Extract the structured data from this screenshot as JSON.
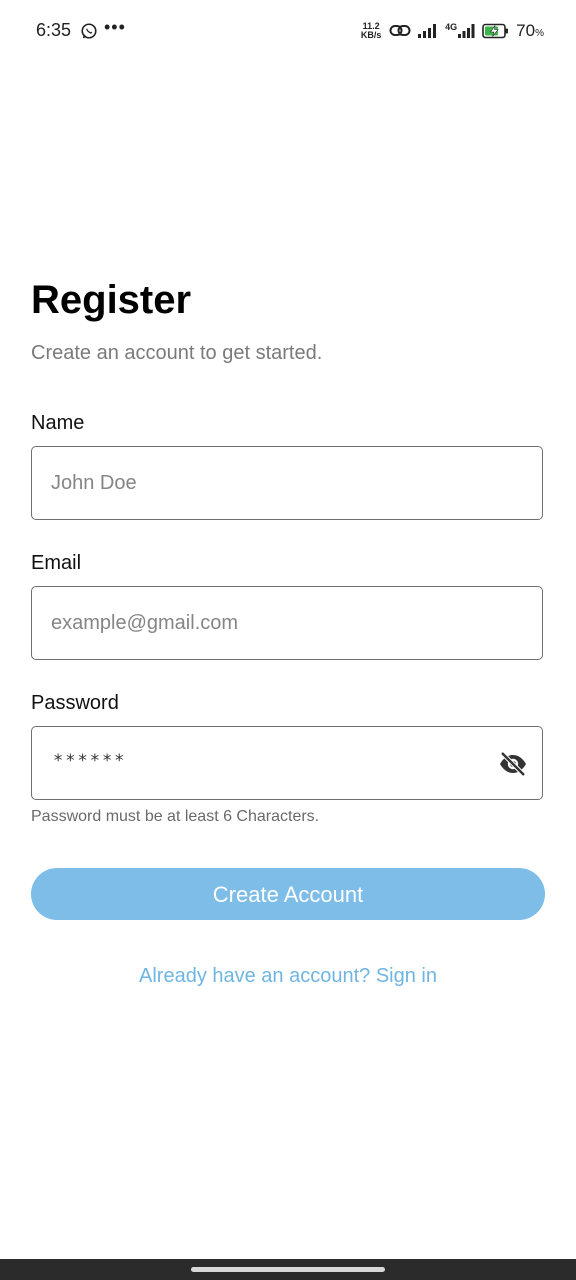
{
  "status_bar": {
    "time": "6:35",
    "net_speed_value": "11.2",
    "net_speed_unit": "KB/s",
    "network_type": "4G",
    "battery_percent": "70",
    "battery_unit": "%",
    "icons": [
      "whatsapp-icon",
      "more-dots-icon",
      "link-icon",
      "signal-icon",
      "battery-charging-icon"
    ]
  },
  "header": {
    "title": "Register",
    "subtitle": "Create an account to get started."
  },
  "form": {
    "name": {
      "label": "Name",
      "placeholder": "John Doe",
      "value": ""
    },
    "email": {
      "label": "Email",
      "placeholder": "example@gmail.com",
      "value": ""
    },
    "password": {
      "label": "Password",
      "masked_value": "******",
      "helper": "Password must be at least 6 Characters.",
      "toggle_icon": "eye-off-icon"
    },
    "submit_label": "Create Account",
    "signin_link": "Already have an account? Sign in"
  },
  "colors": {
    "button_bg": "#7dbde8",
    "link": "#6fb5e2"
  }
}
